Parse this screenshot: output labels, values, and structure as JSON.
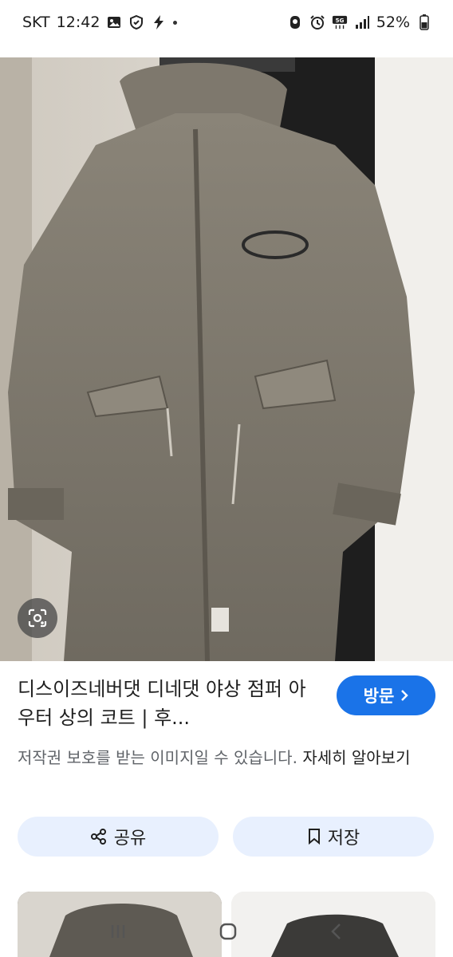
{
  "status_bar": {
    "carrier": "SKT",
    "time": "12:42",
    "left_icons": [
      "gallery-icon",
      "shield-icon",
      "bolt-icon",
      "dot-icon"
    ],
    "right_icons": [
      "rocket-icon",
      "alarm-icon",
      "5g-icon",
      "signal-icon"
    ],
    "battery": "52%"
  },
  "image": {
    "description_icon": "lens-icon"
  },
  "result": {
    "title": "디스이즈네버댓 디네댓 야상 점퍼 아우터 상의 코트 | 후...",
    "visit_label": "방문",
    "copyright_notice": "저작권 보호를 받는 이미지일 수 있습니다. ",
    "learn_more": "자세히 알아보기",
    "share_label": "공유",
    "save_label": "저장"
  },
  "nav": {
    "recents": "recents-icon",
    "home": "home-icon",
    "back": "back-icon"
  },
  "colors": {
    "accent": "#1a73e8",
    "button_bg": "#e8f0fe"
  }
}
